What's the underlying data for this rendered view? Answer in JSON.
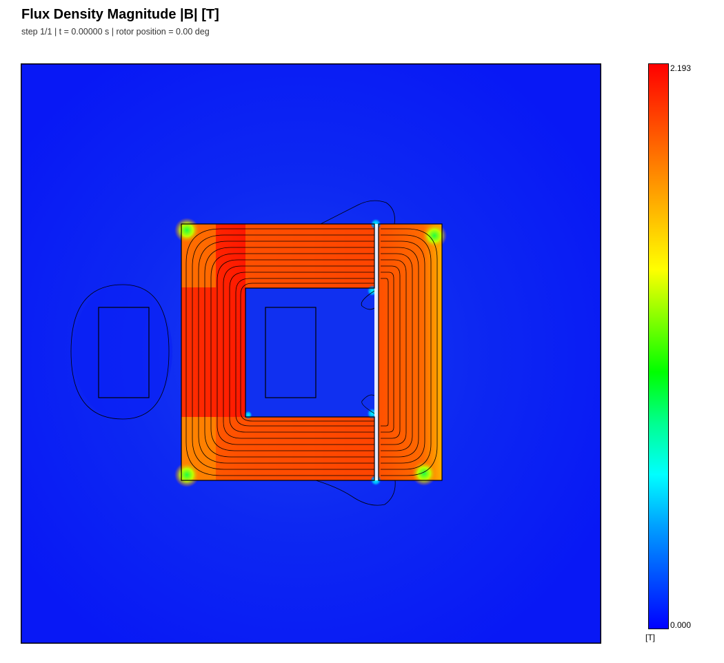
{
  "header": {
    "title": "Flux Density Magnitude |B|  [T]",
    "subtitle": "step 1/1  |  t = 0.00000 s  |  rotor position = 0.00 deg"
  },
  "colorbar": {
    "max_label": "2.193",
    "min_label": "0.000",
    "unit_label": "[T]",
    "stops": [
      "#0000ff",
      "#0050ff",
      "#00a0ff",
      "#00ffff",
      "#00ff90",
      "#00ff00",
      "#80ff00",
      "#ffff00",
      "#ffc000",
      "#ff8000",
      "#ff4000",
      "#ff0000"
    ]
  },
  "colors": {
    "background_field": "#0a1ef5",
    "core_high": "#ff3c00",
    "core_peak": "#ff1a00",
    "outline": "#000000"
  }
}
